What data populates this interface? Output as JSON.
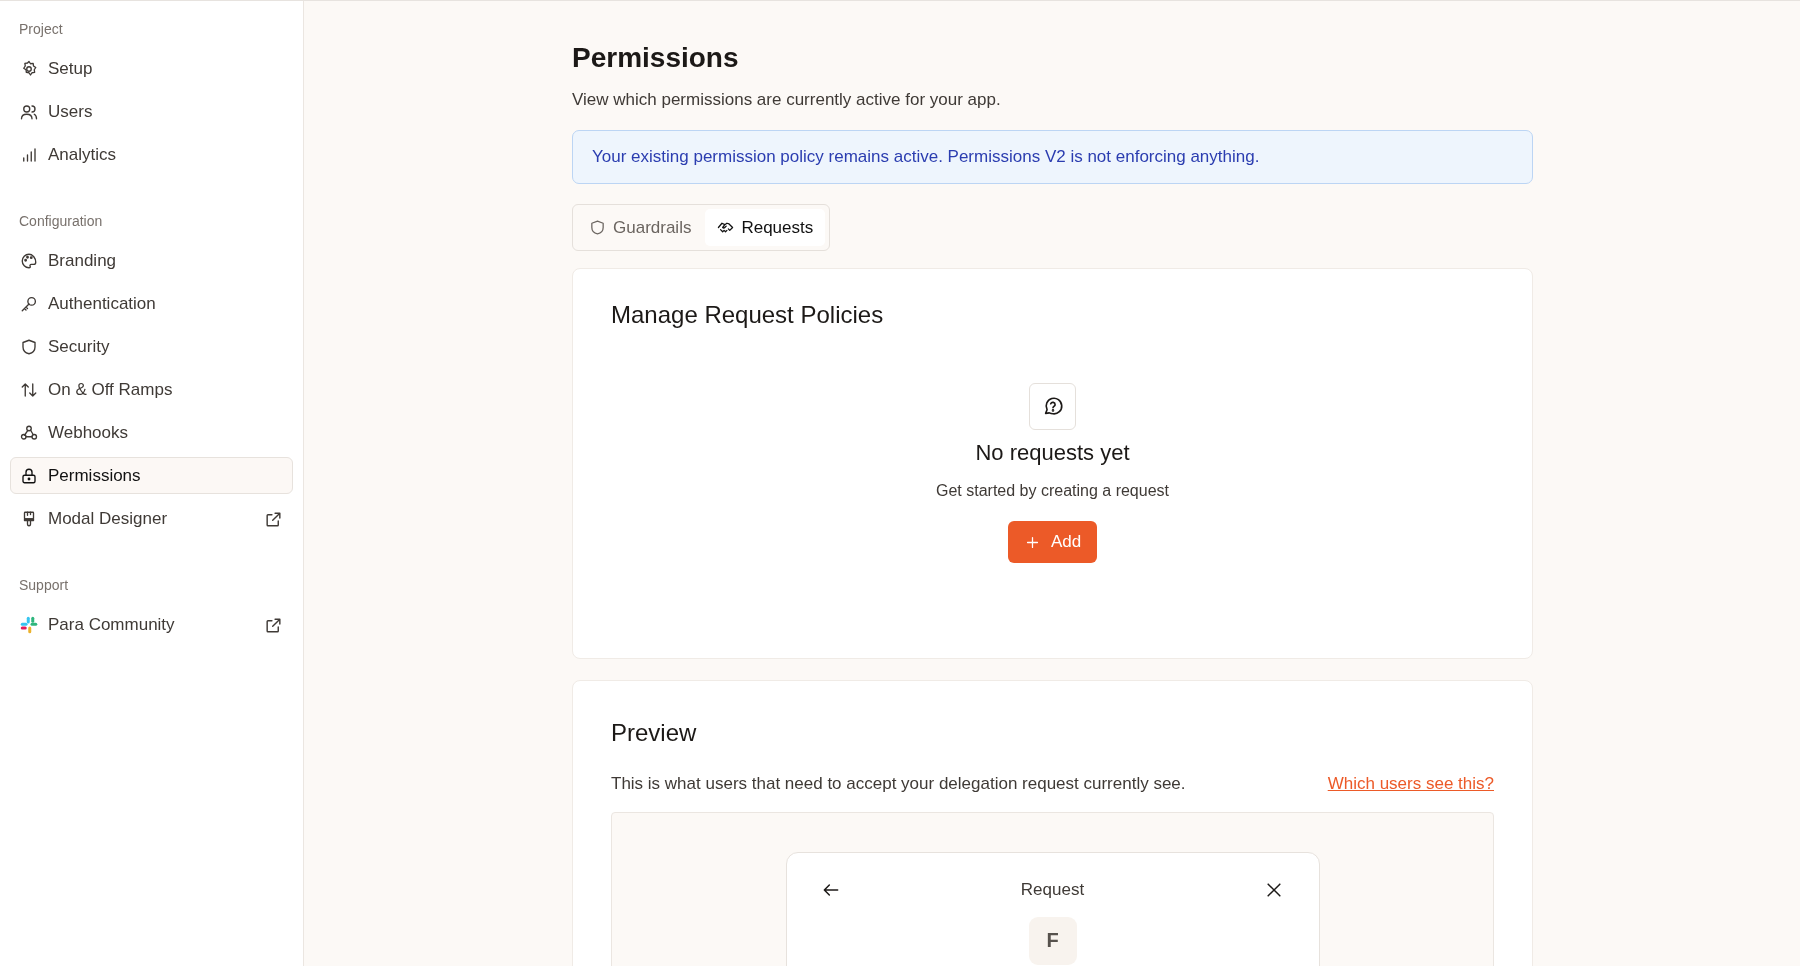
{
  "sidebar": {
    "sections": [
      {
        "title": "Project",
        "items": [
          {
            "label": "Setup",
            "selected": false,
            "external": false
          },
          {
            "label": "Users",
            "selected": false,
            "external": false
          },
          {
            "label": "Analytics",
            "selected": false,
            "external": false
          }
        ]
      },
      {
        "title": "Configuration",
        "items": [
          {
            "label": "Branding",
            "selected": false,
            "external": false
          },
          {
            "label": "Authentication",
            "selected": false,
            "external": false
          },
          {
            "label": "Security",
            "selected": false,
            "external": false
          },
          {
            "label": "On & Off Ramps",
            "selected": false,
            "external": false
          },
          {
            "label": "Webhooks",
            "selected": false,
            "external": false
          },
          {
            "label": "Permissions",
            "selected": true,
            "external": false
          },
          {
            "label": "Modal Designer",
            "selected": false,
            "external": true
          }
        ]
      },
      {
        "title": "Support",
        "items": [
          {
            "label": "Para Community",
            "selected": false,
            "external": true
          }
        ]
      }
    ]
  },
  "page": {
    "title": "Permissions",
    "subtitle": "View which permissions are currently active for your app.",
    "alert": "Your existing permission policy remains active. Permissions V2 is not enforcing anything.",
    "tabs": [
      {
        "label": "Guardrails",
        "selected": false
      },
      {
        "label": "Requests",
        "selected": true
      }
    ]
  },
  "policies": {
    "title": "Manage Request Policies",
    "empty_title": "No requests yet",
    "empty_text": "Get started by creating a request",
    "add_button": "Add"
  },
  "preview": {
    "title": "Preview",
    "description": "This is what users that need to accept your delegation request currently see.",
    "link": "Which users see this?",
    "modal": {
      "title": "Request",
      "avatar": "F"
    }
  }
}
